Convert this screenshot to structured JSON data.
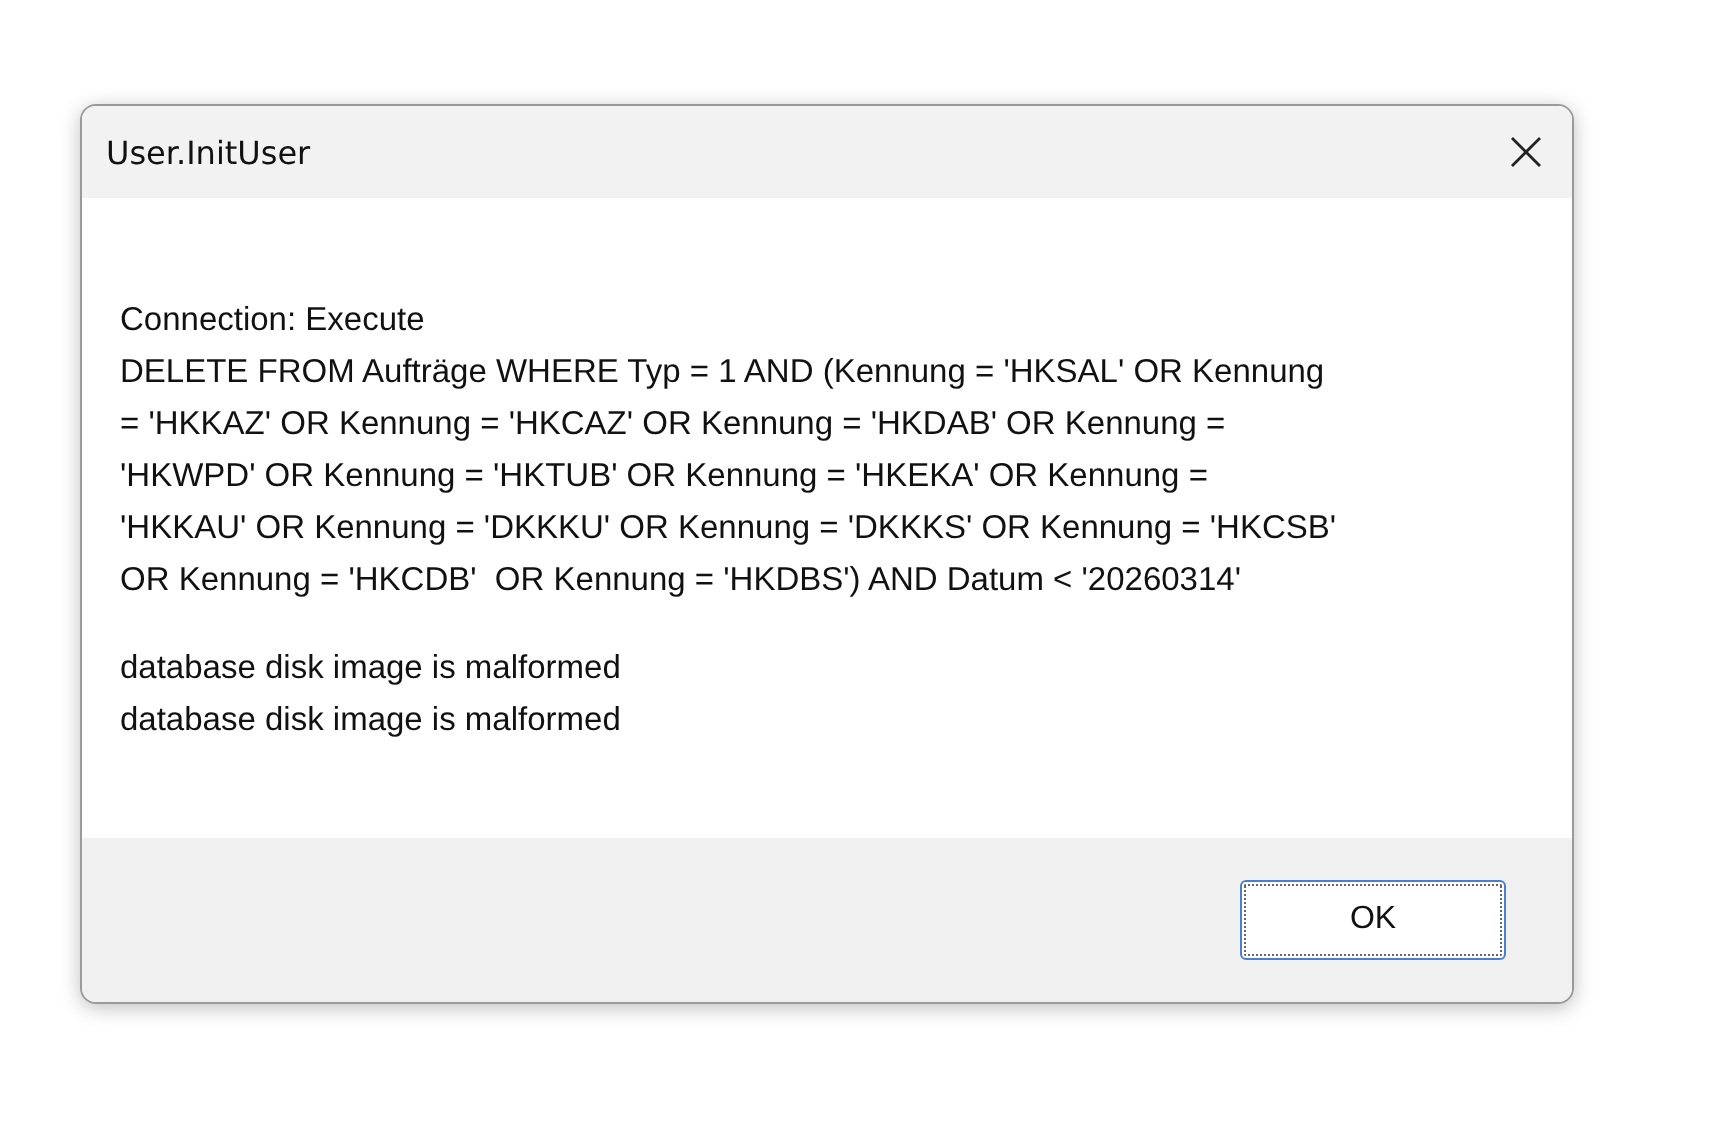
{
  "window": {
    "title": "User.InitUser"
  },
  "message": [
    "Connection: Execute",
    "DELETE FROM Aufträge WHERE Typ = 1 AND (Kennung = 'HKSAL' OR Kennung",
    "= 'HKKAZ' OR Kennung = 'HKCAZ' OR Kennung = 'HKDAB' OR Kennung =",
    "'HKWPD' OR Kennung = 'HKTUB' OR Kennung = 'HKEKA' OR Kennung =",
    "'HKKAU' OR Kennung = 'DKKKU' OR Kennung = 'DKKKS' OR Kennung = 'HKCSB'",
    "OR Kennung = 'HKCDB'  OR Kennung = 'HKDBS') AND Datum < '20260314'"
  ],
  "error": [
    "database disk image is malformed",
    "database disk image is malformed"
  ],
  "buttons": [
    {
      "label": "OK",
      "selected": true
    }
  ]
}
